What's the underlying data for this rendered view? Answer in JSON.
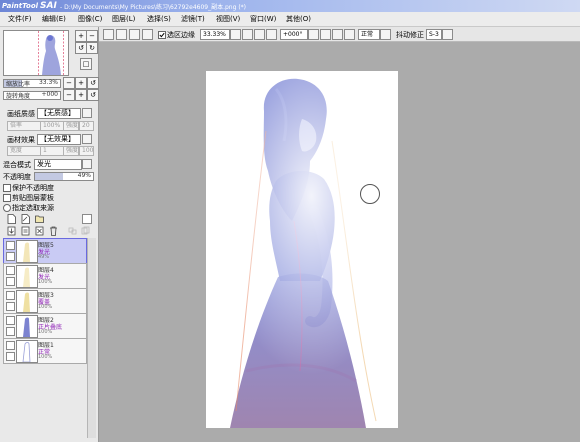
{
  "window": {
    "app_name_prefix": "PaintTool",
    "app_name": "SAI",
    "doc_path": "- D:\\My Documents\\My Pictures\\练习\\62792e4609_副本.png (*)"
  },
  "menu": [
    "文件(F)",
    "编辑(E)",
    "图像(C)",
    "图层(L)",
    "选择(S)",
    "滤镜(T)",
    "视图(V)",
    "窗口(W)",
    "其他(O)"
  ],
  "navigator": {
    "zoom_label": "缩放比率",
    "zoom_value": "33.3%",
    "zoom_fill": 0.33,
    "angle_label": "旋转角度",
    "angle_value": "+000",
    "minus": "−",
    "plus": "+"
  },
  "paint": {
    "texture_label": "画纸质感",
    "texture_value": "【无质感】",
    "texture_scale_placeholder": "倍率",
    "texture_scale_value": "100%",
    "texture_strength_placeholder": "强度",
    "texture_strength_value": "20",
    "effect_label": "画材效果",
    "effect_value": "【无效果】",
    "effect_width_placeholder": "宽度",
    "effect_width_value": "1",
    "effect_strength_placeholder": "强度",
    "effect_strength_value": "100"
  },
  "blend": {
    "label": "混合模式",
    "value": "发光",
    "opacity_label": "不透明度",
    "opacity_value": "49%",
    "opacity_fill": 0.49
  },
  "options": {
    "protect_opacity": "保护不透明度",
    "clip_group": "剪贴图层蒙板",
    "selection_source": "指定选取来源"
  },
  "layers": [
    {
      "name": "图层5",
      "mode": "发光",
      "opacity": "49%",
      "selected": true
    },
    {
      "name": "图层4",
      "mode": "发光",
      "opacity": "100%",
      "selected": false
    },
    {
      "name": "图层3",
      "mode": "覆盖",
      "opacity": "100%",
      "selected": false
    },
    {
      "name": "图层2",
      "mode": "正片叠底",
      "opacity": "100%",
      "selected": false
    },
    {
      "name": "图层1",
      "mode": "正常",
      "opacity": "100%",
      "selected": false
    }
  ],
  "toolbar": {
    "selection_edge_label": "选区边缘",
    "selection_edge_checked": true,
    "zoom_value": "33.33%",
    "angle_value": "+000°",
    "view_mode": "正常",
    "stabilizer_label": "抖动修正",
    "stabilizer_value": "S-3"
  },
  "colors": {
    "titlebar": "#6d86d6",
    "selected_layer": "#c9cbf4",
    "layer_mode_text": "#8d1fb5",
    "workspace": "#ababab"
  }
}
